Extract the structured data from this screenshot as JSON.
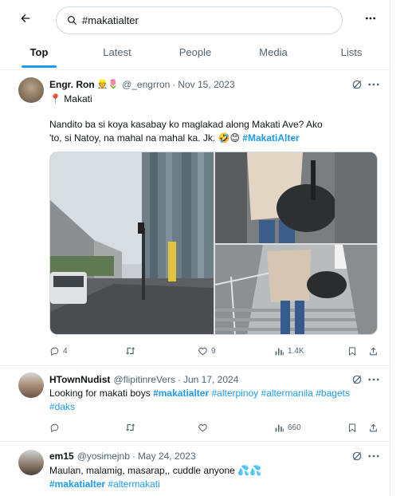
{
  "search": {
    "value": "#makatialter"
  },
  "tabs": [
    {
      "label": "Top"
    },
    {
      "label": "Latest"
    },
    {
      "label": "People"
    },
    {
      "label": "Media"
    },
    {
      "label": "Lists"
    }
  ],
  "tweets": [
    {
      "name": "Engr. Ron",
      "name_emoji": "👷🌷",
      "handle": "@_engrron",
      "date": "Nov 15, 2023",
      "location": "📍 Makati",
      "text_a": "Nandito ba si koya kasabay ko maglakad along Makati Ave? Ako 'to, si Natoy, na mahal na mahal ka. Jk. 🤣😊",
      "hashtags": [
        "#MakatiAlter"
      ],
      "replies": "4",
      "reposts": "",
      "likes": "9",
      "views": "1.4K"
    },
    {
      "name": "HTownNudist",
      "handle": "@flipitinreVers",
      "date": "Jun 17, 2024",
      "text_a": "Looking for makati boys",
      "hashtags": [
        "#makatialter",
        "#alterpinoy",
        "#altermanila",
        "#bagets",
        "#daks"
      ],
      "replies": "",
      "reposts": "",
      "likes": "",
      "views": "660"
    },
    {
      "name": "em15",
      "handle": "@yosimejnb",
      "date": "May 24, 2023",
      "text_a": "Maulan, malamig, masarap,, cuddle anyone 💦💦",
      "hashtags": [
        "#makatialter",
        "#altermakati"
      ]
    }
  ],
  "colors": {
    "accent": "#1d9bf0",
    "text": "#0f1419",
    "muted": "#536471",
    "border": "#eff3f4"
  }
}
